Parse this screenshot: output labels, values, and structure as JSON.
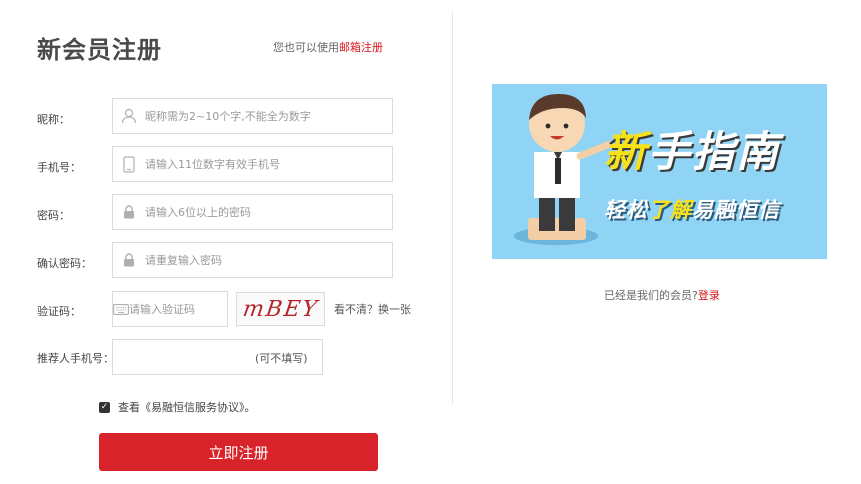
{
  "header": {
    "title": "新会员注册",
    "alt_prefix": "您也可以使用",
    "alt_link": "邮箱注册"
  },
  "form": {
    "nickname": {
      "label": "昵称：",
      "placeholder": "昵称需为2~10个字,不能全为数字",
      "icon": "user-icon"
    },
    "phone": {
      "label": "手机号：",
      "placeholder": "请输入11位数字有效手机号",
      "icon": "phone-icon"
    },
    "password": {
      "label": "密码：",
      "placeholder": "请输入6位以上的密码",
      "icon": "lock-icon"
    },
    "confirm": {
      "label": "确认密码：",
      "placeholder": "请重复输入密码",
      "icon": "lock-icon"
    },
    "captcha": {
      "label": "验证码：",
      "placeholder": "请输入验证码",
      "icon": "keyboard-icon",
      "image_text": "mBEY",
      "refresh_text": "看不清？换一张"
    },
    "referrer": {
      "label": "推荐人手机号：",
      "optional_text": "(可不填写)"
    },
    "agreement": {
      "text": "查看《易融恒信服务协议》。",
      "checked": true
    },
    "submit_label": "立即注册"
  },
  "banner": {
    "title_part1": "新",
    "title_part2": "手指南",
    "subtitle_part1": "轻松",
    "subtitle_part2": "了解",
    "subtitle_part3": "易融恒信",
    "bg_color": "#8fd3f5"
  },
  "footer": {
    "login_prefix": "已经是我们的会员?",
    "login_link": "登录"
  },
  "colors": {
    "accent": "#d9232a"
  }
}
